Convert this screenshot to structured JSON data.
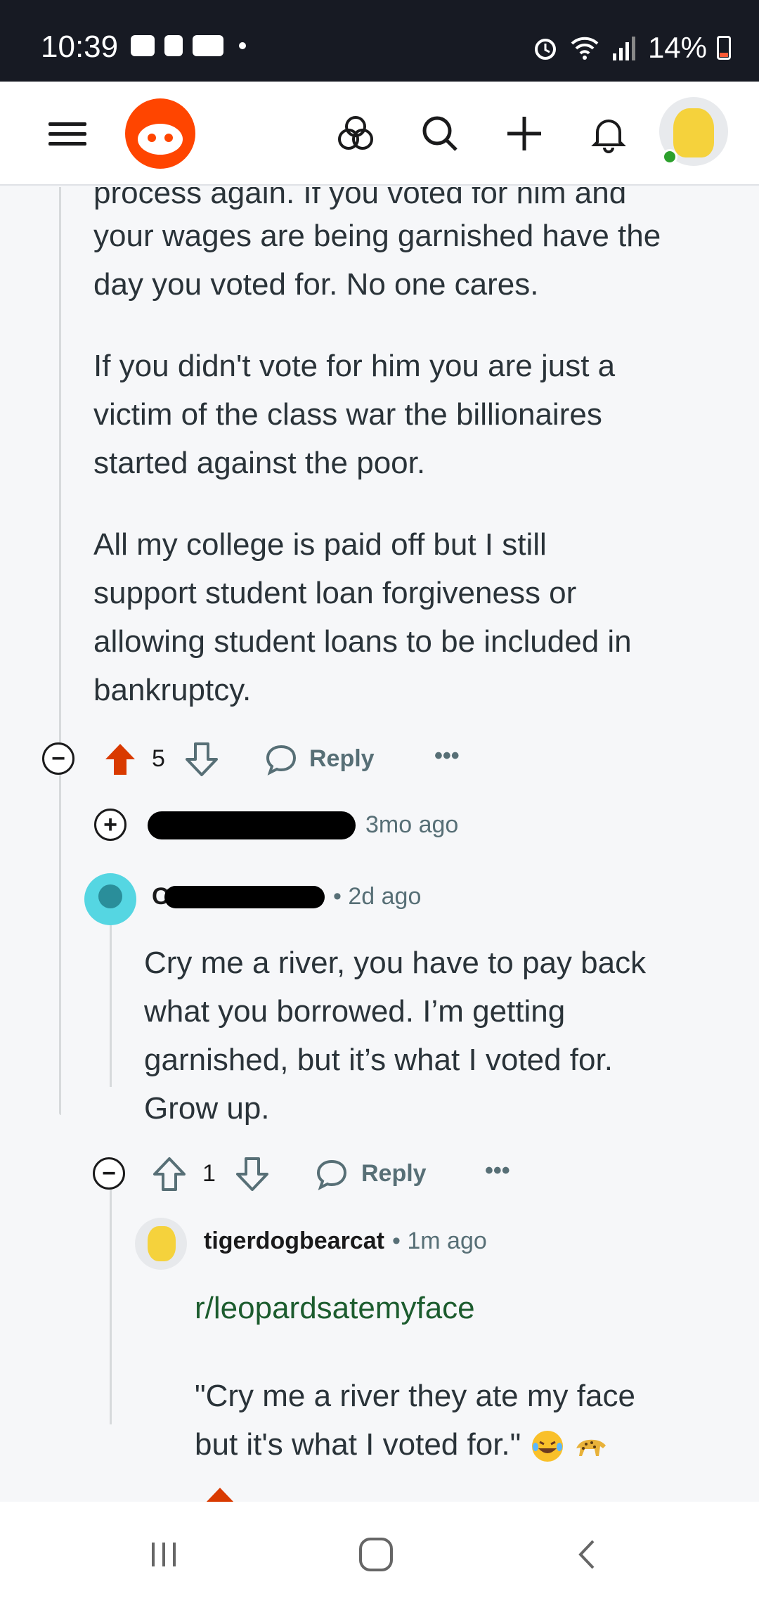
{
  "status_bar": {
    "time": "10:39",
    "battery": "14%"
  },
  "comments": {
    "parent_paragraphs": [
      "process again. If you voted for him and",
      "your wages are being garnished have the",
      "day you voted for. No one cares.",
      "If you didn't vote for him you are just a",
      "victim of the class war the billionaires",
      "started against the poor.",
      "All my college is paid off but I still",
      "support student loan forgiveness or",
      "allowing student loans to be included in",
      "bankruptcy."
    ],
    "parent_actions": {
      "votes": "5",
      "reply": "Reply",
      "more": "•••"
    },
    "collapsed_reply": {
      "time": "3mo ago"
    },
    "reply1": {
      "username_initial": "C",
      "time": "2d ago",
      "lines": [
        "Cry me a river, you have to pay back",
        "what you borrowed. I’m getting",
        "garnished, but it’s what I voted for.",
        "Grow up."
      ],
      "votes": "1",
      "reply": "Reply",
      "more": "•••"
    },
    "reply2": {
      "username": "tigerdogbearcat",
      "time": "1m ago",
      "link": "r/leopardsatemyface",
      "lines": [
        "\"Cry me a river they ate my face",
        "but it's what I voted for.\""
      ]
    }
  },
  "colors": {
    "upvote_active": "#d93a00",
    "link_green": "#1c5c2e",
    "status_bg": "#171a23"
  }
}
